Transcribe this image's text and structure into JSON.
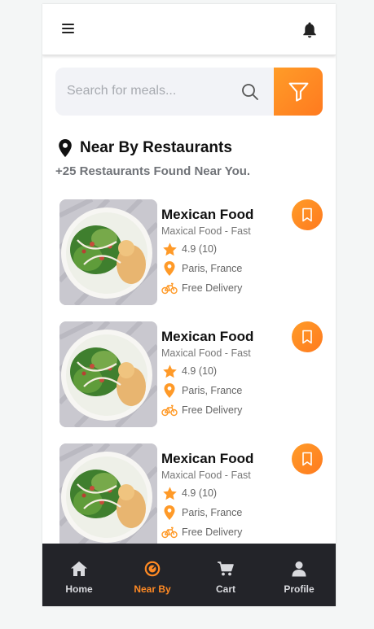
{
  "header": {
    "menu_icon": "hamburger-menu-icon",
    "notification_icon": "bell-icon"
  },
  "search": {
    "placeholder": "Search for meals...",
    "value": "",
    "search_icon": "search-icon",
    "filter_icon": "filter-icon"
  },
  "section": {
    "icon": "location-pin-icon",
    "title": "Near By Restaurants",
    "subtitle": "+25 Restaurants Found Near You."
  },
  "restaurants": [
    {
      "name": "Mexican Food",
      "subtitle": "Maxical Food - Fast",
      "rating": "4.9 (10)",
      "location": "Paris, France",
      "delivery": "Free Delivery"
    },
    {
      "name": "Mexican Food",
      "subtitle": "Maxical Food - Fast",
      "rating": "4.9 (10)",
      "location": "Paris, France",
      "delivery": "Free Delivery"
    },
    {
      "name": "Mexican Food",
      "subtitle": "Maxical Food - Fast",
      "rating": "4.9 (10)",
      "location": "Paris, France",
      "delivery": "Free Delivery"
    }
  ],
  "nav": [
    {
      "label": "Home",
      "icon": "home-icon",
      "active": false
    },
    {
      "label": "Near By",
      "icon": "near-by-icon",
      "active": true
    },
    {
      "label": "Cart",
      "icon": "cart-icon",
      "active": false
    },
    {
      "label": "Profile",
      "icon": "profile-icon",
      "active": false
    }
  ],
  "colors": {
    "accent": "#ff8a24",
    "nav_background": "#232429",
    "search_background": "#f2f3f7"
  }
}
